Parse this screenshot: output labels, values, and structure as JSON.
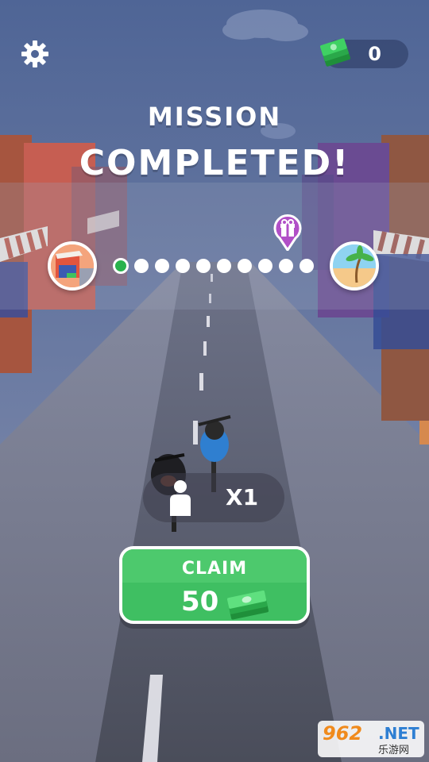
{
  "hud": {
    "settings_icon": "gear-icon",
    "cash_icon": "cash-stack-icon",
    "cash_count": "0"
  },
  "title": {
    "line1": "MISSION",
    "line2": "COMPLETED!"
  },
  "progress": {
    "start_icon": "city-street-thumbnail",
    "end_icon": "beach-palm-thumbnail",
    "reward_icon": "gift-pin-icon",
    "dots_total": 10,
    "dots_completed": 1
  },
  "multiplier": {
    "icon": "person-icon",
    "label": "X1"
  },
  "claim": {
    "label": "CLAIM",
    "amount": "50",
    "icon": "cash-stack-icon"
  },
  "watermark": {
    "num": "962",
    "net": ".NET",
    "sub": "乐游网"
  },
  "colors": {
    "green": "#3fbf62",
    "dot_active": "#29b24c",
    "sky": "#5b6f9a"
  }
}
